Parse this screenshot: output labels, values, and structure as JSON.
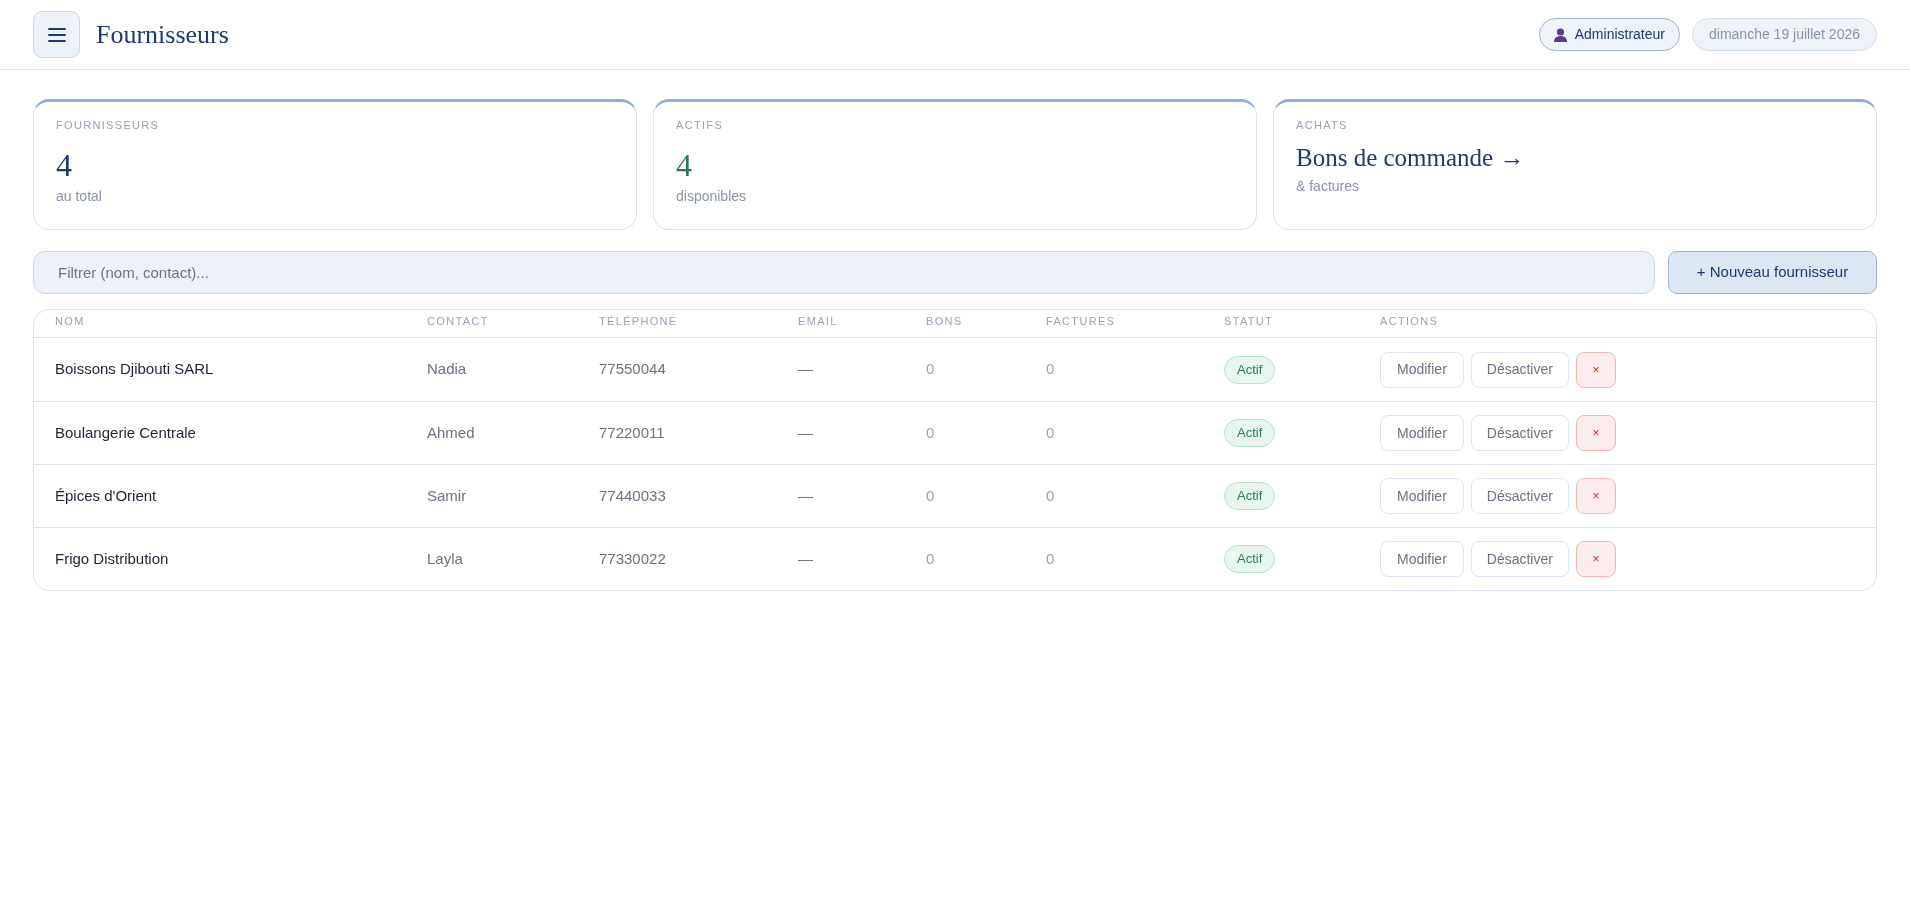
{
  "header": {
    "title": "Fournisseurs",
    "user": "Administrateur",
    "date": "dimanche 19 juillet 2026"
  },
  "stats": [
    {
      "kind": "total",
      "label": "FOURNISSEURS",
      "value": "4",
      "caption": "au total"
    },
    {
      "kind": "active",
      "label": "ACTIFS",
      "value": "4",
      "caption": "disponibles"
    },
    {
      "kind": "link",
      "label": "ACHATS",
      "value": "Bons de commande →",
      "caption": "& factures"
    }
  ],
  "filter": {
    "placeholder": "Filtrer (nom, contact)..."
  },
  "new_button": "+ Nouveau fournisseur",
  "table": {
    "columns": [
      "NOM",
      "CONTACT",
      "TÉLÉPHONE",
      "EMAIL",
      "BONS",
      "FACTURES",
      "STATUT",
      "ACTIONS"
    ],
    "rows": [
      {
        "name": "Boissons Djibouti SARL",
        "contact": "Nadia",
        "phone": "77550044",
        "email": "—",
        "bons": "0",
        "factures": "0",
        "status": {
          "kind": "active",
          "label": "Actif"
        },
        "actions": [
          {
            "kind": "edit",
            "label": "Modifier"
          },
          {
            "kind": "toggle",
            "label": "Désactiver"
          },
          {
            "kind": "delete",
            "label": "×"
          }
        ]
      },
      {
        "name": "Boulangerie Centrale",
        "contact": "Ahmed",
        "phone": "77220011",
        "email": "—",
        "bons": "0",
        "factures": "0",
        "status": {
          "kind": "active",
          "label": "Actif"
        },
        "actions": [
          {
            "kind": "edit",
            "label": "Modifier"
          },
          {
            "kind": "toggle",
            "label": "Désactiver"
          },
          {
            "kind": "delete",
            "label": "×"
          }
        ]
      },
      {
        "name": "Épices d'Orient",
        "contact": "Samir",
        "phone": "77440033",
        "email": "—",
        "bons": "0",
        "factures": "0",
        "status": {
          "kind": "active",
          "label": "Actif"
        },
        "actions": [
          {
            "kind": "edit",
            "label": "Modifier"
          },
          {
            "kind": "toggle",
            "label": "Désactiver"
          },
          {
            "kind": "delete",
            "label": "×"
          }
        ]
      },
      {
        "name": "Frigo Distribution",
        "contact": "Layla",
        "phone": "77330022",
        "email": "—",
        "bons": "0",
        "factures": "0",
        "status": {
          "kind": "active",
          "label": "Actif"
        },
        "actions": [
          {
            "kind": "edit",
            "label": "Modifier"
          },
          {
            "kind": "toggle",
            "label": "Désactiver"
          },
          {
            "kind": "delete",
            "label": "×"
          }
        ]
      }
    ]
  }
}
